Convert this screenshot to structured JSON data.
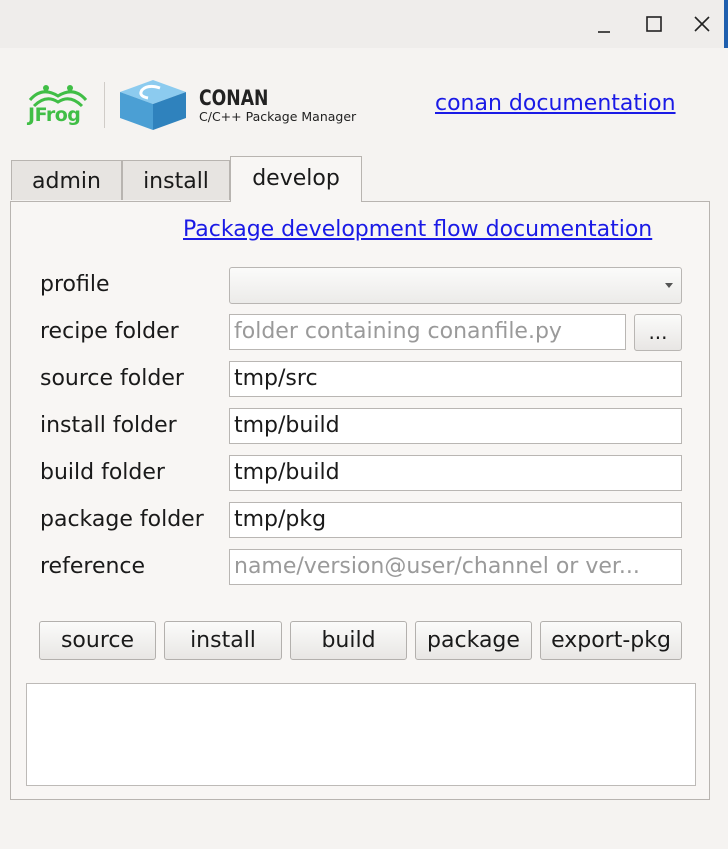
{
  "window": {
    "controls": [
      "minimize",
      "maximize",
      "close"
    ]
  },
  "branding": {
    "jfrog_label": "JFrog",
    "conan_title": "CONAN",
    "conan_subtitle": "C/C++ Package Manager",
    "doc_link": "conan documentation"
  },
  "tabs": [
    {
      "label": "admin",
      "selected": false
    },
    {
      "label": "install",
      "selected": false
    },
    {
      "label": "develop",
      "selected": true
    }
  ],
  "develop": {
    "flow_link": "Package development flow documentation",
    "fields": {
      "profile": {
        "label": "profile",
        "value": ""
      },
      "recipe_folder": {
        "label": "recipe folder",
        "value": "",
        "placeholder": "folder containing conanfile.py"
      },
      "source_folder": {
        "label": "source folder",
        "value": "tmp/src"
      },
      "install_folder": {
        "label": "install folder",
        "value": "tmp/build"
      },
      "build_folder": {
        "label": "build folder",
        "value": "tmp/build"
      },
      "package_folder": {
        "label": "package folder",
        "value": "tmp/pkg"
      },
      "reference": {
        "label": "reference",
        "value": "",
        "placeholder": "name/version@user/channel or ver..."
      }
    },
    "browse_label": "...",
    "buttons": {
      "source": "source",
      "install": "install",
      "build": "build",
      "package": "package",
      "export_pkg": "export-pkg"
    },
    "output": ""
  },
  "colors": {
    "link": "#1a1ae6",
    "jfrog_green": "#40be46",
    "conan_blue": "#5aa6d6"
  }
}
